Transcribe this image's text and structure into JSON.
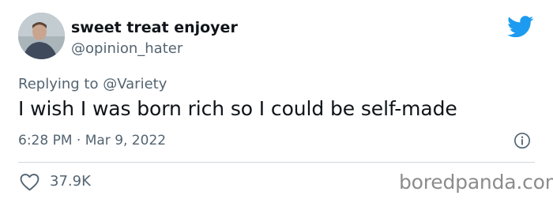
{
  "tweet": {
    "author": {
      "display_name": "sweet treat enjoyer",
      "handle": "@opinion_hater"
    },
    "reply_prefix": "Replying to",
    "reply_to": "@Variety",
    "text": "I wish I was born rich so I could be self-made",
    "timestamp": "6:28 PM · Mar 9, 2022",
    "like_count": "37.9K"
  },
  "icons": {
    "brand": "twitter-bird-icon",
    "info": "info-icon",
    "like": "heart-icon"
  },
  "colors": {
    "twitter_blue": "#1d9bf0",
    "secondary_text": "#536471",
    "primary_text": "#0f1419"
  },
  "watermark": "boredpanda.com"
}
